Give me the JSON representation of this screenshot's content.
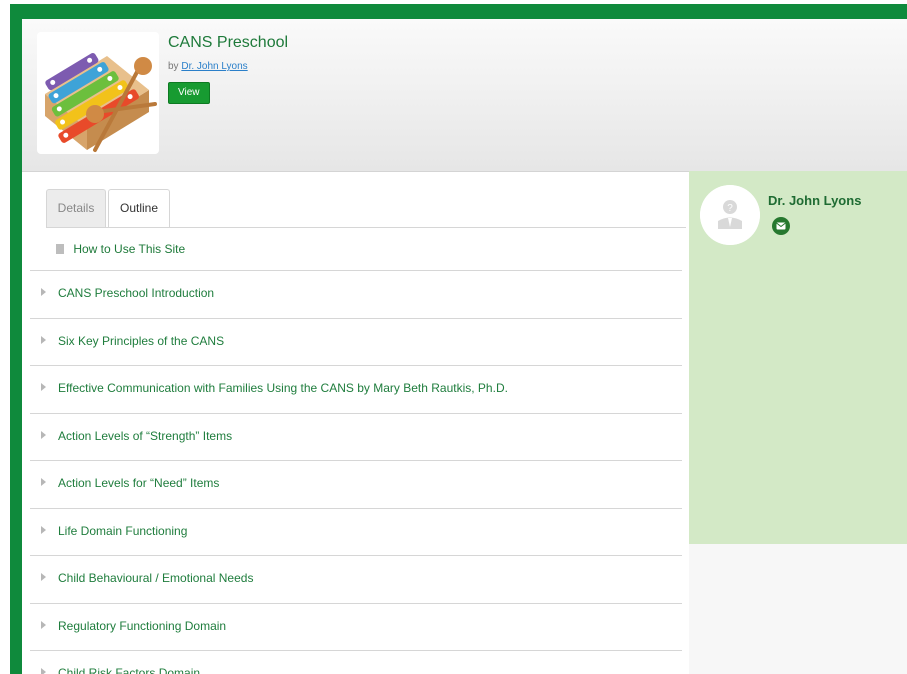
{
  "course": {
    "title": "CANS Preschool",
    "by_prefix": "by",
    "author_link": "Dr. John Lyons",
    "view_button": "View",
    "thumbnail_icon": "xylophone-image"
  },
  "sidebar": {
    "author_name": "Dr. John Lyons",
    "avatar_icon": "unknown-person-avatar",
    "contact_icon": "mail-icon"
  },
  "tabs": [
    {
      "label": "Details",
      "active": false
    },
    {
      "label": "Outline",
      "active": true
    }
  ],
  "outline": {
    "intro_link": "How to Use This Site",
    "items": [
      "CANS Preschool Introduction",
      "Six Key Principles of the CANS",
      "Effective Communication with Families Using the CANS by Mary Beth Rautkis, Ph.D.",
      "Action Levels of “Strength” Items",
      "Action Levels for “Need” Items",
      "Life Domain Functioning",
      "Child Behavioural / Emotional Needs",
      "Regulatory Functioning Domain",
      "Child Risk Factors Domain"
    ]
  },
  "colors": {
    "frame_green": "#0f8a3c",
    "link_green": "#1f7d3d",
    "sidebar_bg": "#d3e9c6",
    "button_green": "#179b31"
  }
}
